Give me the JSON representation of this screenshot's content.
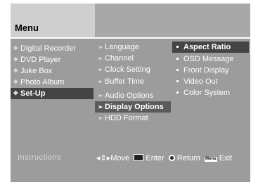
{
  "menu": {
    "title": "Menu"
  },
  "col1": [
    "Digital Recorder",
    "DVD Player",
    "Juke Box",
    "Photo Album",
    "Set-Up"
  ],
  "col2": [
    "Language",
    "Channel",
    "Clock Setting",
    "Buffer Time",
    "Audio Options",
    "Display Options",
    "HDD Format"
  ],
  "col3": [
    "Aspect Ratio",
    "OSD Message",
    "Front Display",
    "Video Out",
    "Color System"
  ],
  "instructions": {
    "label": "Instructions",
    "move": "Move",
    "enter": "Enter",
    "return": "Return",
    "menu_key": "Menu",
    "exit": "Exit"
  },
  "colors": {
    "panel": "#9c9c9c",
    "header": "#cfcfcf",
    "selected": "#444444"
  },
  "icons": {
    "col1": "diamond-bullet-icon",
    "col2": "arrow-bullet-icon",
    "col3": "square-bullet-icon"
  }
}
